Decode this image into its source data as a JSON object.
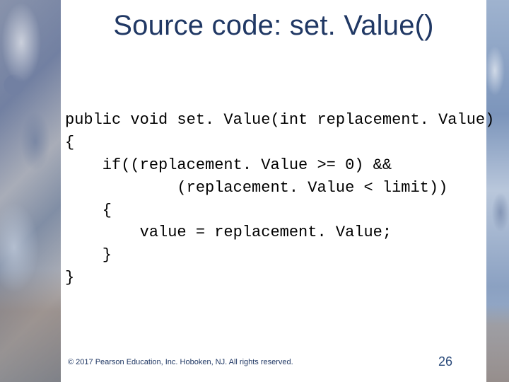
{
  "title": "Source code:  set. Value()",
  "code": {
    "l1": "public void set. Value(int replacement. Value)",
    "l2": "{",
    "l3": "    if((replacement. Value >= 0) &&",
    "l4": "            (replacement. Value < limit))",
    "l5": "    {",
    "l6": "        value = replacement. Value;",
    "l7": "    }",
    "l8": "}"
  },
  "footer": {
    "copyright": "© 2017 Pearson Education, Inc. Hoboken, NJ. All rights reserved.",
    "page": "26"
  }
}
